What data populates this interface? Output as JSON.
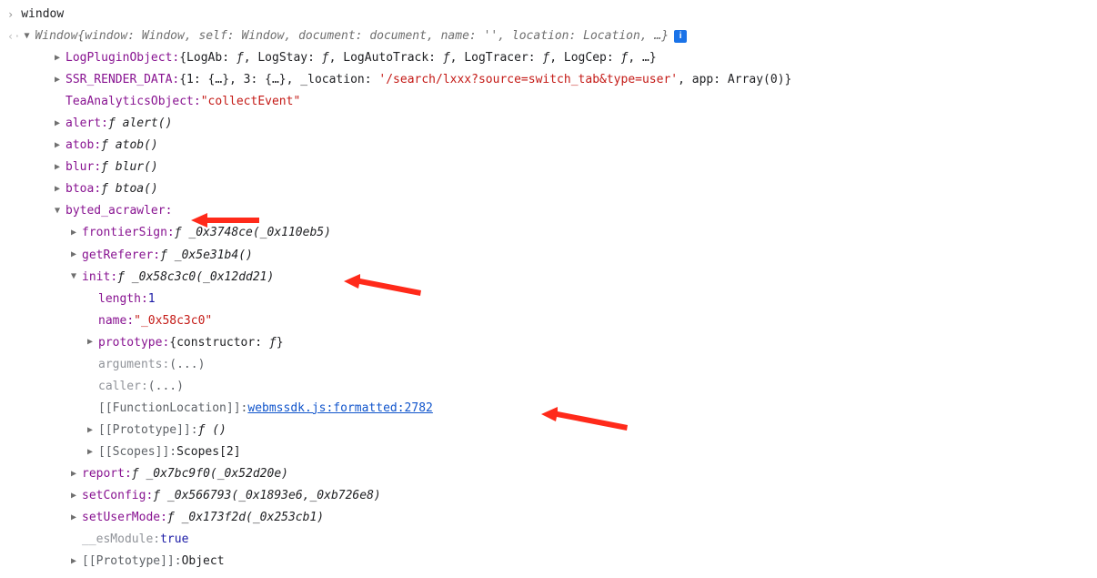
{
  "lines": {
    "input_cmd": "window",
    "window_head": "Window",
    "window_preview": [
      {
        "k": "window",
        "v": "Window"
      },
      {
        "k": "self",
        "v": "Window"
      },
      {
        "k": "document",
        "v": "document"
      },
      {
        "k": "name",
        "v": "''"
      },
      {
        "k": "location",
        "v": "Location"
      }
    ],
    "ellipsis": ", …",
    "info_icon": "i",
    "log_plugin_key": "LogPluginObject",
    "log_plugin_parts": "{LogAb: ƒ, LogStay: ƒ, LogAutoTrack: ƒ, LogTracer: ƒ, LogCep: ƒ, …}",
    "ssr_key": "SSR_RENDER_DATA",
    "ssr_head": "{1: {…}, 3: {…}, _location: ",
    "ssr_loc": "'/search/lxxx?source=switch_tab&type=user'",
    "ssr_tail": ", app: Array(0)}",
    "tea_key": "TeaAnalyticsObject",
    "tea_val": "\"collectEvent\"",
    "alert_key": "alert",
    "alert_val": "ƒ alert()",
    "atob_key": "atob",
    "atob_val": "ƒ atob()",
    "blur_key": "blur",
    "blur_val": "ƒ blur()",
    "btoa_key": "btoa",
    "btoa_val": "ƒ btoa()",
    "crawler_key": "byted_acrawler",
    "frontier_key": "frontierSign",
    "frontier_val": "ƒ _0x3748ce(_0x110eb5)",
    "referer_key": "getReferer",
    "referer_val": "ƒ _0x5e31b4()",
    "init_key": "init",
    "init_val": "ƒ _0x58c3c0(_0x12dd21)",
    "length_key": "length",
    "length_val": "1",
    "name_key": "name",
    "name_val": "\"_0x58c3c0\"",
    "proto_inner_key": "prototype",
    "proto_inner_val": "{constructor: ƒ}",
    "arguments_key": "arguments",
    "arguments_val": "(...)",
    "caller_key": "caller",
    "caller_val": "(...)",
    "funcloc_key": "[[FunctionLocation]]",
    "funcloc_val": "webmssdk.js:formatted:2782",
    "protobrk_key": "[[Prototype]]",
    "protobrk_val": "ƒ ()",
    "scopes_key": "[[Scopes]]",
    "scopes_val": "Scopes[2]",
    "report_key": "report",
    "report_val": "ƒ _0x7bc9f0(_0x52d20e)",
    "setconfig_key": "setConfig",
    "setconfig_val": "ƒ _0x566793(_0x1893e6,_0xb726e8)",
    "setuser_key": "setUserMode",
    "setuser_val": "ƒ _0x173f2d(_0x253cb1)",
    "esmodule_key": "__esModule",
    "esmodule_val": "true",
    "outerproto_key": "[[Prototype]]",
    "outerproto_val": "Object"
  }
}
